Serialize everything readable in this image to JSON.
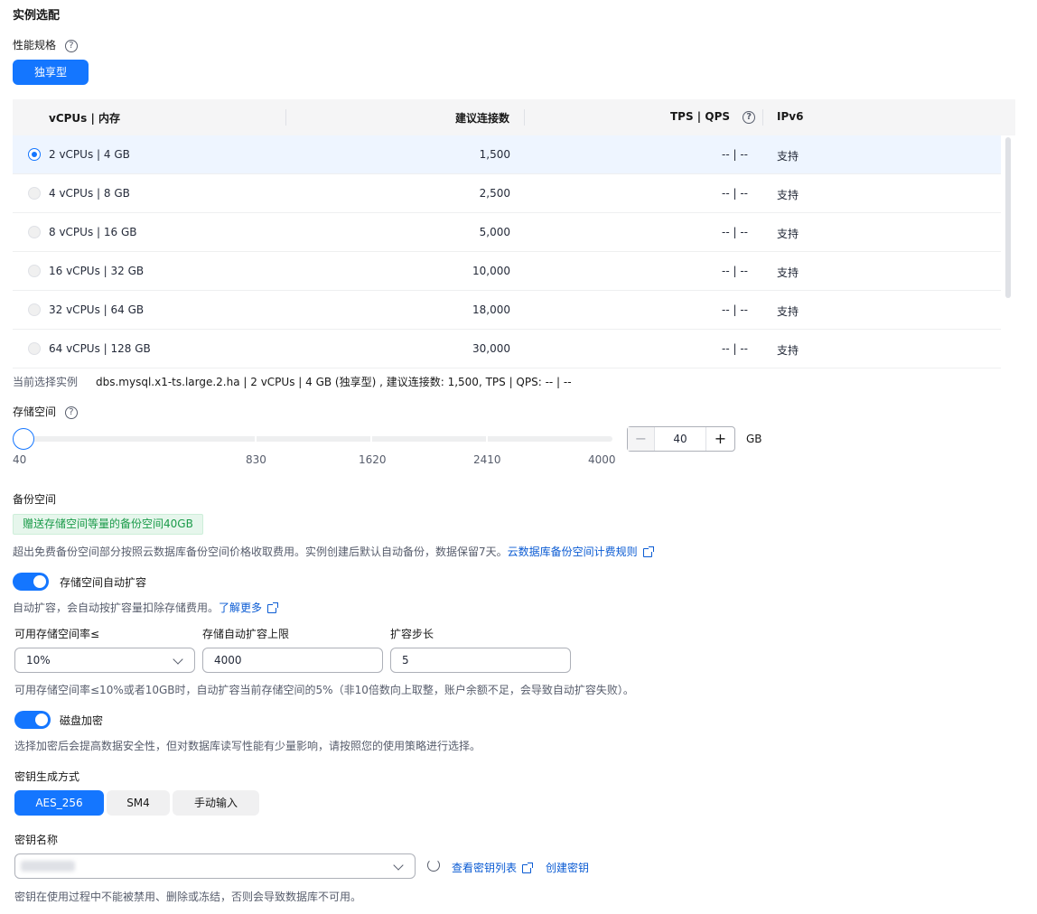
{
  "section_title": "实例选配",
  "perf_spec": {
    "label": "性能规格",
    "type_button": "独享型"
  },
  "table": {
    "headers": [
      "vCPUs | 内存",
      "建议连接数",
      "TPS | QPS",
      "IPv6"
    ],
    "rows": [
      {
        "spec": "2 vCPUs | 4 GB",
        "connections": "1,500",
        "tps_qps": "-- | --",
        "ipv6": "支持",
        "selected": true
      },
      {
        "spec": "4 vCPUs | 8 GB",
        "connections": "2,500",
        "tps_qps": "-- | --",
        "ipv6": "支持",
        "selected": false
      },
      {
        "spec": "8 vCPUs | 16 GB",
        "connections": "5,000",
        "tps_qps": "-- | --",
        "ipv6": "支持",
        "selected": false
      },
      {
        "spec": "16 vCPUs | 32 GB",
        "connections": "10,000",
        "tps_qps": "-- | --",
        "ipv6": "支持",
        "selected": false
      },
      {
        "spec": "32 vCPUs | 64 GB",
        "connections": "18,000",
        "tps_qps": "-- | --",
        "ipv6": "支持",
        "selected": false
      },
      {
        "spec": "64 vCPUs | 128 GB",
        "connections": "30,000",
        "tps_qps": "-- | --",
        "ipv6": "支持",
        "selected": false
      }
    ]
  },
  "current_selection": {
    "label": "当前选择实例",
    "value": "dbs.mysql.x1-ts.large.2.ha | 2 vCPUs | 4 GB (独享型) , 建议连接数: 1,500, TPS | QPS: -- | --"
  },
  "storage": {
    "label": "存储空间",
    "ticks": [
      "40",
      "830",
      "1620",
      "2410",
      "4000"
    ],
    "value": "40",
    "unit": "GB",
    "minus": "−",
    "plus": "+"
  },
  "backup": {
    "label": "备份空间",
    "tag": "赠送存储空间等量的备份空间40GB",
    "desc": "超出免费备份空间部分按照云数据库备份空间价格收取费用。实例创建后默认自动备份，数据保留7天。",
    "link": "云数据库备份空间计费规则"
  },
  "autoscale": {
    "toggle_label": "存储空间自动扩容",
    "desc": "自动扩容，会自动按扩容量扣除存储费用。",
    "link": "了解更多",
    "fields": {
      "ratio_label": "可用存储空间率≤",
      "ratio_value": "10%",
      "limit_label": "存储自动扩容上限",
      "limit_value": "4000",
      "step_label": "扩容步长",
      "step_value": "5"
    },
    "note": "可用存储空间率≤10%或者10GB时，自动扩容当前存储空间的5%（非10倍数向上取整，账户余额不足，会导致自动扩容失败）。"
  },
  "encryption": {
    "toggle_label": "磁盘加密",
    "desc": "选择加密后会提高数据安全性，但对数据库读写性能有少量影响，请按照您的使用策略进行选择。",
    "key_method_label": "密钥生成方式",
    "methods": [
      "AES_256",
      "SM4",
      "手动输入"
    ],
    "key_name_label": "密钥名称",
    "view_keys_link": "查看密钥列表",
    "create_key_link": "创建密钥",
    "warning": "密钥在使用过程中不能被禁用、删除或冻结，否则会导致数据库不可用。"
  },
  "colors": {
    "accent": "#1476ff",
    "link": "#0a5bd3",
    "success": "#1b9b4a"
  }
}
